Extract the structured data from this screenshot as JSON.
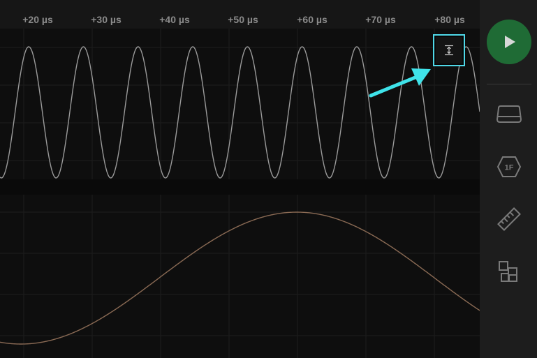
{
  "timeline": {
    "ticks": [
      "+20 µs",
      "+30 µs",
      "+40 µs",
      "+50 µs",
      "+60 µs",
      "+70 µs",
      "+80 µs"
    ]
  },
  "channels": [
    {
      "color": "#9a9a9a"
    },
    {
      "color": "#8a6a54"
    }
  ],
  "sidebar": {
    "run_icon": "play-icon",
    "tools": [
      {
        "icon": "trigger-icon"
      },
      {
        "icon": "filter-1f-icon",
        "text": "1F"
      },
      {
        "icon": "ruler-icon"
      },
      {
        "icon": "layout-blocks-icon"
      }
    ]
  },
  "autoscale_button": {
    "icon": "vertical-autoscale-icon",
    "highlight_color": "#4fd8e8"
  },
  "colors": {
    "accent_green": "#1f6b35",
    "highlight": "#3fe3ea"
  }
}
